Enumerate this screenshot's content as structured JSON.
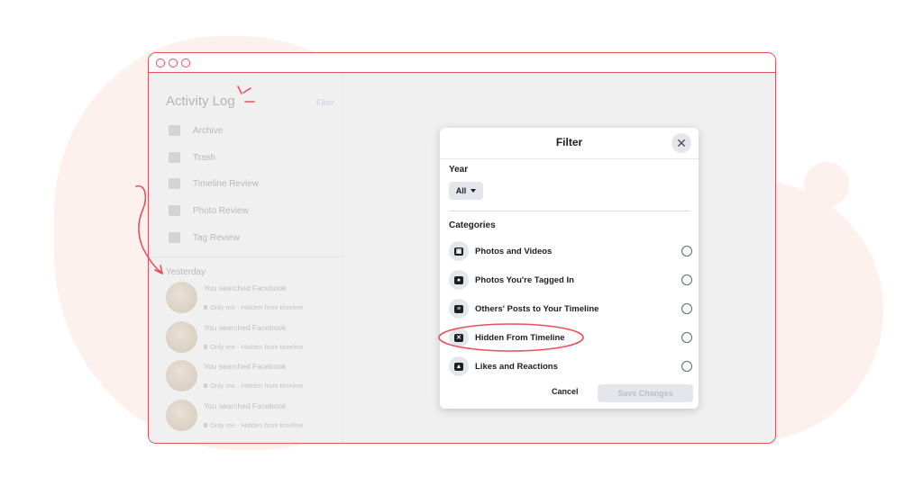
{
  "colors": {
    "accent": "#e8505b",
    "modal_bg": "#ffffff",
    "page_bg": "#f0f0f0"
  },
  "sidebar": {
    "title": "Activity Log",
    "filter_link": "Filter",
    "items": [
      {
        "label": "Archive",
        "icon": "archive-icon"
      },
      {
        "label": "Trash",
        "icon": "trash-icon"
      },
      {
        "label": "Timeline Review",
        "icon": "timeline-review-icon"
      },
      {
        "label": "Photo Review",
        "icon": "photo-review-icon"
      },
      {
        "label": "Tag Review",
        "icon": "tag-icon"
      }
    ],
    "section": "Yesterday",
    "activities": [
      {
        "text": "You searched Facebook",
        "meta": "Only me · Hidden from timeline"
      },
      {
        "text": "You searched Facebook",
        "meta": "Only me · Hidden from timeline"
      },
      {
        "text": "You searched Facebook",
        "meta": "Only me · Hidden from timeline"
      },
      {
        "text": "You searched Facebook",
        "meta": "Only me · Hidden from timeline"
      }
    ]
  },
  "modal": {
    "title": "Filter",
    "close_icon": "close-icon",
    "year_label": "Year",
    "year_value": "All",
    "categories_label": "Categories",
    "categories": [
      {
        "label": "Photos and Videos",
        "icon": "photo-icon",
        "glyph": "▣"
      },
      {
        "label": "Photos You're Tagged In",
        "icon": "tagged-person-icon",
        "glyph": "●"
      },
      {
        "label": "Others' Posts to Your Timeline",
        "icon": "post-icon",
        "glyph": "≡"
      },
      {
        "label": "Hidden From Timeline",
        "icon": "hidden-icon",
        "glyph": "✕"
      },
      {
        "label": "Likes and Reactions",
        "icon": "thumbs-up-icon",
        "glyph": "▲"
      }
    ],
    "cancel_label": "Cancel",
    "save_label": "Save Changes"
  }
}
